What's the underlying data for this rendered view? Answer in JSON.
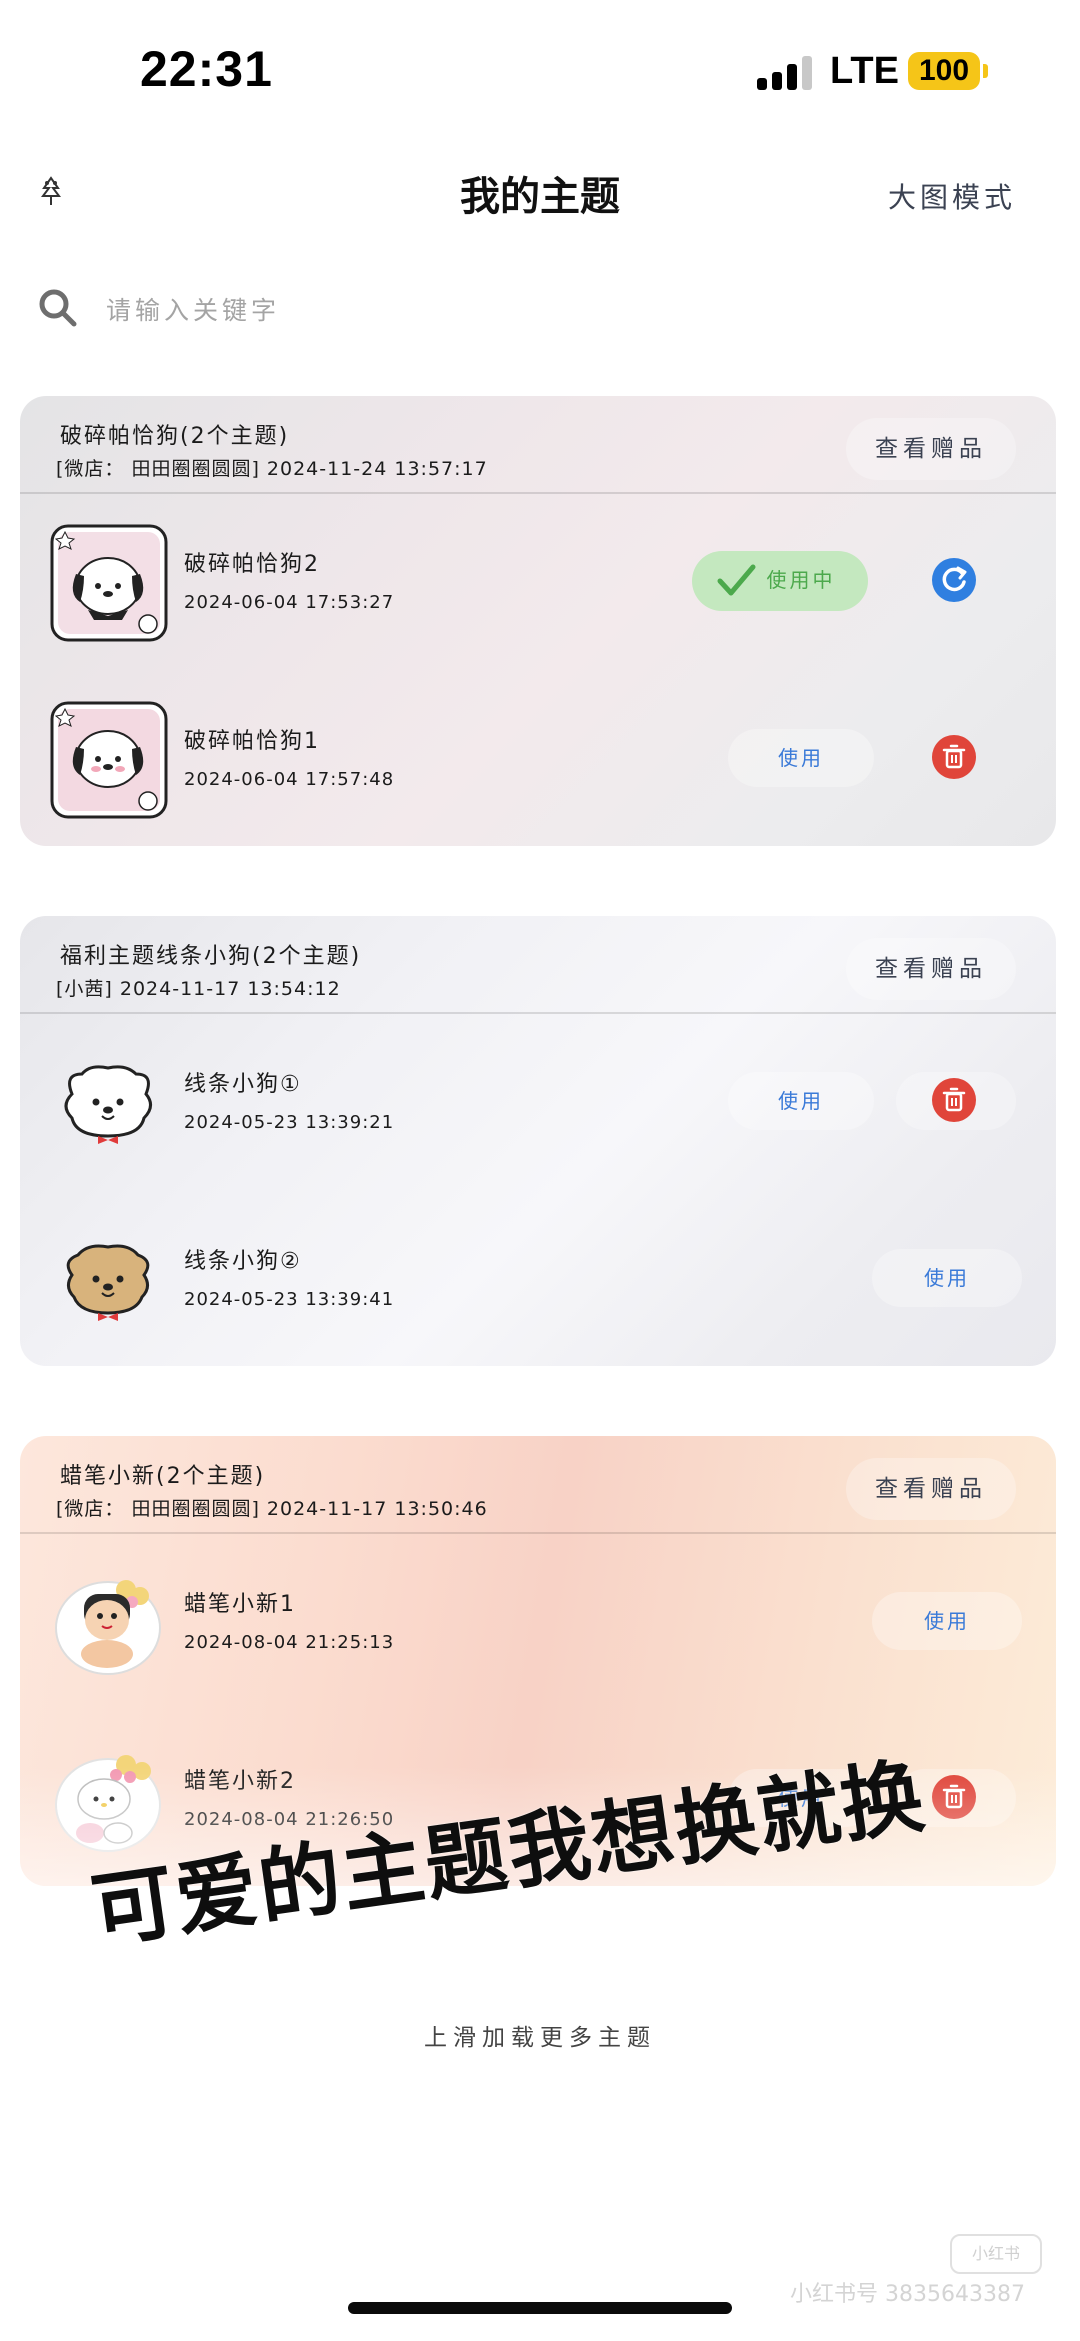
{
  "status_bar": {
    "time": "22:31",
    "carrier": "LTE",
    "battery": "100",
    "signal_bars": 3
  },
  "nav": {
    "title": "我的主题",
    "right_action": "大图模式",
    "left_icon": "tree-icon"
  },
  "search": {
    "placeholder": "请输入关键字",
    "value": ""
  },
  "groups": [
    {
      "name": "破碎帕恰狗(2个主题)",
      "meta": "[微店： 田田圈圈圆圆]  2024-11-24  13:57:17",
      "gifts_label": "查看赠品",
      "themes": [
        {
          "title": "破碎帕恰狗2",
          "date": "2024-06-04  17:53:27",
          "action_label": "使用中",
          "status": "active",
          "icon": "refresh-icon"
        },
        {
          "title": "破碎帕恰狗1",
          "date": "2024-06-04  17:57:48",
          "action_label": "使用",
          "status": "available",
          "icon": "trash-icon"
        }
      ]
    },
    {
      "name": "福利主题线条小狗(2个主题)",
      "meta": "[小茜]  2024-11-17  13:54:12",
      "gifts_label": "查看赠品",
      "themes": [
        {
          "title": "线条小狗①",
          "date": "2024-05-23  13:39:21",
          "action_label": "使用",
          "status": "available",
          "icon": "trash-icon"
        },
        {
          "title": "线条小狗②",
          "date": "2024-05-23  13:39:41",
          "action_label": "使用",
          "status": "available"
        }
      ]
    },
    {
      "name": "蜡笔小新(2个主题)",
      "meta": "[微店： 田田圈圈圆圆]  2024-11-17  13:50:46",
      "gifts_label": "查看赠品",
      "themes": [
        {
          "title": "蜡笔小新1",
          "date": "2024-08-04  21:25:13",
          "action_label": "使用",
          "status": "available"
        },
        {
          "title": "蜡笔小新2",
          "date": "2024-08-04  21:26:50",
          "action_label": "使用",
          "status": "available",
          "icon": "trash-icon"
        }
      ]
    }
  ],
  "overlay_caption": "可爱的主题我想换就换",
  "load_more": "上滑加载更多主题",
  "watermark": {
    "logo": "小红书",
    "text": "小红书号 3835643387"
  },
  "colors": {
    "active_bg": "#c4e8bf",
    "active_text": "#4ca94c",
    "link_blue": "#3a7ad8",
    "refresh_blue": "#2f7fe0",
    "delete_red": "#e0453a"
  }
}
